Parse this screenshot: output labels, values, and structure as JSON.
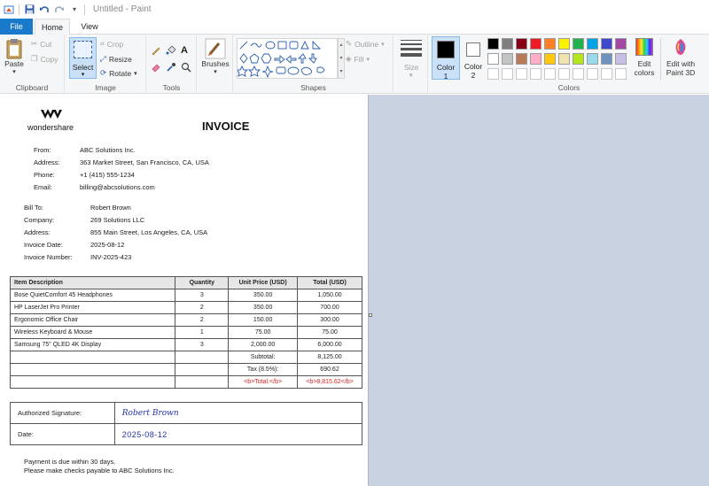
{
  "window": {
    "title": "Untitled - Paint"
  },
  "tabs": {
    "file": "File",
    "home": "Home",
    "view": "View"
  },
  "clipboard": {
    "paste": "Paste",
    "cut": "Cut",
    "copy": "Copy",
    "label": "Clipboard"
  },
  "image": {
    "select": "Select",
    "crop": "Crop",
    "resize": "Resize",
    "rotate": "Rotate",
    "label": "Image"
  },
  "tools": {
    "label": "Tools"
  },
  "brushes": {
    "label": "Brushes"
  },
  "shapes": {
    "outline": "Outline",
    "fill": "Fill",
    "label": "Shapes"
  },
  "size": {
    "label": "Size"
  },
  "colors": {
    "color1_label": "Color",
    "color1_num": "1",
    "color2_label": "Color",
    "color2_num": "2",
    "edit_colors_1": "Edit",
    "edit_colors_2": "colors",
    "edit3d_1": "Edit with",
    "edit3d_2": "Paint 3D",
    "label": "Colors",
    "color1_value": "#000000",
    "color2_value": "#ffffff",
    "palette_row1": [
      "#000000",
      "#7f7f7f",
      "#880015",
      "#ed1c24",
      "#ff7f27",
      "#fff200",
      "#22b14c",
      "#00a2e8",
      "#3f48cc",
      "#a349a4"
    ],
    "palette_row2": [
      "#ffffff",
      "#c3c3c3",
      "#b97a57",
      "#ffaec9",
      "#ffc90e",
      "#efe4b0",
      "#b5e61d",
      "#99d9ea",
      "#7092be",
      "#c8bfe7"
    ]
  },
  "invoice": {
    "logo": "wondershare",
    "title": "INVOICE",
    "from_label": "From:",
    "from_value": "ABC Solutions Inc.",
    "address_label": "Address:",
    "address_value": "363 Market Street, San Francisco, CA, USA",
    "phone_label": "Phone:",
    "phone_value": "+1 (415) 555-1234",
    "email_label": "Email:",
    "email_value": "billing@abcsolutions.com",
    "billto_label": "Bill To:",
    "billto_value": "Robert Brown",
    "company_label": "Company:",
    "company_value": "269 Solutions LLC",
    "baddress_label": "Address:",
    "baddress_value": "855 Main Street, Los Angeles, CA, USA",
    "idate_label": "Invoice Date:",
    "idate_value": "2025-08-12",
    "inum_label": "Invoice Number:",
    "inum_value": "INV-2025-423",
    "headers": [
      "Item Description",
      "Quantity",
      "Unit Price (USD)",
      "Total (USD)"
    ],
    "rows": [
      [
        "Bose QuietComfort 45 Headphones",
        "3",
        "350.00",
        "1,050.00"
      ],
      [
        "HP LaserJet Pro Printer",
        "2",
        "350.00",
        "700.00"
      ],
      [
        "Ergonomic Office Chair",
        "2",
        "150.00",
        "300.00"
      ],
      [
        "Wireless Keyboard & Mouse",
        "1",
        "75.00",
        "75.00"
      ],
      [
        "Samsung 75\" QLED 4K Display",
        "3",
        "2,000.00",
        "6,000.00"
      ]
    ],
    "subtotal_label": "Subtotal:",
    "subtotal_value": "8,125.00",
    "tax_label": "Tax (8.5%):",
    "tax_value": "690.62",
    "total_label": "<b>Total:</b>",
    "total_value": "<b>8,815.62</b>",
    "sig_label": "Authorized Signature:",
    "sig_value": "Robert Brown",
    "date_label": "Date:",
    "date_value": "2025-08-12",
    "note1": "Payment is due within 30 days.",
    "note2": "Please make checks payable to ABC Solutions Inc."
  }
}
